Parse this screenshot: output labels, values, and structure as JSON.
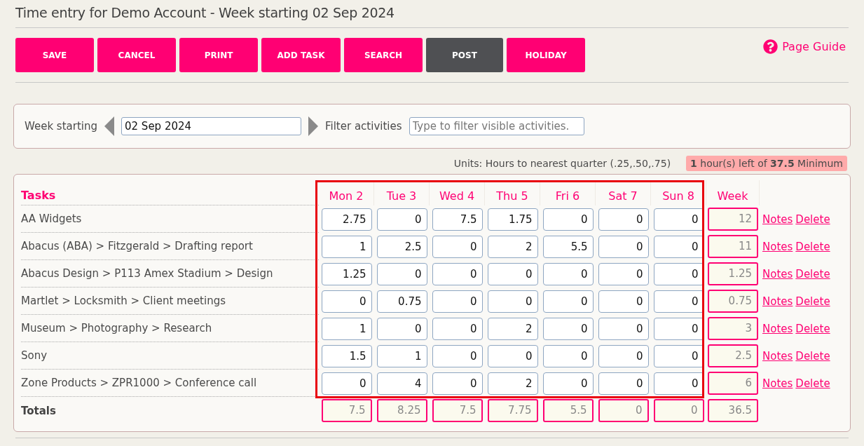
{
  "title": "Time entry for Demo Account - Week starting 02 Sep 2024",
  "toolbar": {
    "buttons": [
      {
        "label": "SAVE",
        "kind": "primary"
      },
      {
        "label": "CANCEL",
        "kind": "primary"
      },
      {
        "label": "PRINT",
        "kind": "primary"
      },
      {
        "label": "ADD TASK",
        "kind": "primary"
      },
      {
        "label": "SEARCH",
        "kind": "primary"
      },
      {
        "label": "POST",
        "kind": "secondary"
      },
      {
        "label": "HOLIDAY",
        "kind": "primary"
      }
    ],
    "page_guide": "Page Guide"
  },
  "filter_bar": {
    "week_label": "Week starting",
    "week_value": "02 Sep 2024",
    "filter_label": "Filter activities",
    "filter_placeholder": "Type to filter visible activities."
  },
  "units_note": "Units: Hours to nearest quarter (.25,.50,.75)",
  "minimum_alert": "**1** hour(s) left of **37.5** Minimum",
  "table": {
    "task_header": "Tasks",
    "day_columns": [
      "Mon 2",
      "Tue 3",
      "Wed 4",
      "Thu 5",
      "Fri 6",
      "Sat 7",
      "Sun 8"
    ],
    "week_header": "Week",
    "rows": [
      {
        "task": "AA Widgets",
        "hours": [
          "2.75",
          "0",
          "7.5",
          "1.75",
          "0",
          "0",
          "0"
        ],
        "week": "12",
        "actions": [
          "Notes",
          "Delete"
        ]
      },
      {
        "task": "Abacus (ABA) > Fitzgerald > Drafting report",
        "hours": [
          "1",
          "2.5",
          "0",
          "2",
          "5.5",
          "0",
          "0"
        ],
        "week": "11",
        "actions": [
          "Notes",
          "Delete"
        ]
      },
      {
        "task": "Abacus Design > P113 Amex Stadium > Design",
        "hours": [
          "1.25",
          "0",
          "0",
          "0",
          "0",
          "0",
          "0"
        ],
        "week": "1.25",
        "actions": [
          "Notes",
          "Delete"
        ]
      },
      {
        "task": "Martlet > Locksmith > Client meetings",
        "hours": [
          "0",
          "0.75",
          "0",
          "0",
          "0",
          "0",
          "0"
        ],
        "week": "0.75",
        "actions": [
          "Notes",
          "Delete"
        ]
      },
      {
        "task": "Museum > Photography > Research",
        "hours": [
          "1",
          "0",
          "0",
          "2",
          "0",
          "0",
          "0"
        ],
        "week": "3",
        "actions": [
          "Notes",
          "Delete"
        ]
      },
      {
        "task": "Sony",
        "hours": [
          "1.5",
          "1",
          "0",
          "0",
          "0",
          "0",
          "0"
        ],
        "week": "2.5",
        "actions": [
          "Notes",
          "Delete"
        ]
      },
      {
        "task": "Zone Products > ZPR1000 > Conference call",
        "hours": [
          "0",
          "4",
          "0",
          "2",
          "0",
          "0",
          "0"
        ],
        "week": "6",
        "actions": [
          "Notes",
          "Delete"
        ]
      }
    ],
    "totals": {
      "label": "Totals",
      "days": [
        "7.5",
        "8.25",
        "7.5",
        "7.75",
        "5.5",
        "0",
        "0"
      ],
      "week": "36.5"
    }
  }
}
